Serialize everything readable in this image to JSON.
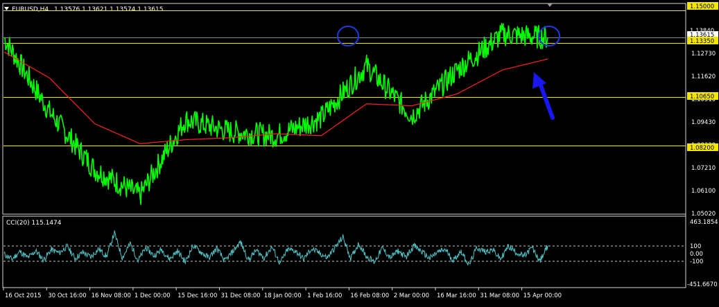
{
  "header": {
    "symbol": "EURUSD,H4",
    "ohlc": "1.13576 1.13621 1.13574 1.13615"
  },
  "indicator": {
    "label": "CCI(20) 115.1474",
    "axis_labels": [
      "463.1854",
      "100",
      "0.00",
      "-100",
      "-451.6670"
    ],
    "levels": [
      100,
      -100
    ],
    "color": "#4fc3c7"
  },
  "price_axis": {
    "labels": [
      "1.13840",
      "1.12730",
      "1.11620",
      "1.10510",
      "1.09430",
      "1.08320",
      "1.07210",
      "1.06100",
      "1.05020"
    ],
    "current_price": "1.13615"
  },
  "horizontal_lines": {
    "values": [
      "1.15000",
      "1.13350",
      "1.10650",
      "1.08200"
    ],
    "color": "#f2e600"
  },
  "time_axis": {
    "labels": [
      "16 Oct 2015",
      "30 Oct 16:00",
      "16 Nov 08:00",
      "1 Dec 00:00",
      "15 Dec 16:00",
      "31 Dec 08:00",
      "18 Jan 00:00",
      "1 Feb 16:00",
      "16 Feb 08:00",
      "2 Mar 00:00",
      "16 Mar 16:00",
      "31 Mar 08:00",
      "15 Apr 00:00"
    ]
  },
  "colors": {
    "background": "#000000",
    "price": "#00ff00",
    "moving_average": "#ff2020",
    "axis_text": "#ffffff",
    "highlight_circle": "#1d3be0",
    "arrow": "#1717ee"
  },
  "chart_data": [
    {
      "type": "line",
      "series": [
        {
          "x": [
            "16 Oct 2015",
            "30 Oct 16:00",
            "16 Nov 08:00",
            "1 Dec 00:00",
            "15 Dec 16:00",
            "31 Dec 08:00",
            "18 Jan 00:00",
            "1 Feb 16:00",
            "16 Feb 08:00",
            "2 Mar 00:00",
            "16 Mar 16:00",
            "31 Mar 08:00",
            "15 Apr 00:00"
          ],
          "values": [
            1.136,
            1.099,
            1.07,
            1.057,
            1.095,
            1.089,
            1.087,
            1.096,
            1.122,
            1.097,
            1.12,
            1.138,
            1.1362
          ]
        },
        {
          "x": [
            "16 Oct 2015",
            "30 Oct 16:00",
            "16 Nov 08:00",
            "1 Dec 00:00",
            "15 Dec 16:00",
            "31 Dec 08:00",
            "18 Jan 00:00",
            "1 Feb 16:00",
            "16 Feb 08:00",
            "2 Mar 00:00",
            "16 Mar 16:00",
            "31 Mar 08:00",
            "15 Apr 00:00"
          ],
          "values": [
            1.129,
            1.116,
            1.093,
            1.083,
            1.085,
            1.086,
            1.088,
            1.087,
            1.103,
            1.102,
            1.108,
            1.12,
            1.1255
          ]
        }
      ],
      "ylim": [
        1.048,
        1.153
      ],
      "ylabels_right": true,
      "grid": false
    },
    {
      "type": "line",
      "series": [
        {
          "values": [
            -10,
            -80,
            30,
            -60,
            40,
            -90,
            60,
            10,
            110,
            -70,
            20,
            -50,
            70,
            -40,
            300,
            -60,
            150,
            -100,
            90,
            -30,
            60,
            -80,
            40,
            -120,
            120,
            20,
            -60,
            80,
            -110,
            30,
            170,
            -90,
            50,
            -60,
            100,
            -140,
            60,
            40,
            -80,
            70,
            10,
            -60,
            90,
            240,
            -70,
            150,
            -40,
            -120,
            80,
            -60,
            40,
            -50,
            120,
            30,
            -70,
            20,
            60,
            -100,
            40,
            -170,
            90,
            30,
            60,
            -80,
            110,
            20,
            -40,
            90,
            -110,
            115
          ]
        }
      ],
      "ylim": [
        -451.667,
        463.1854
      ]
    }
  ]
}
